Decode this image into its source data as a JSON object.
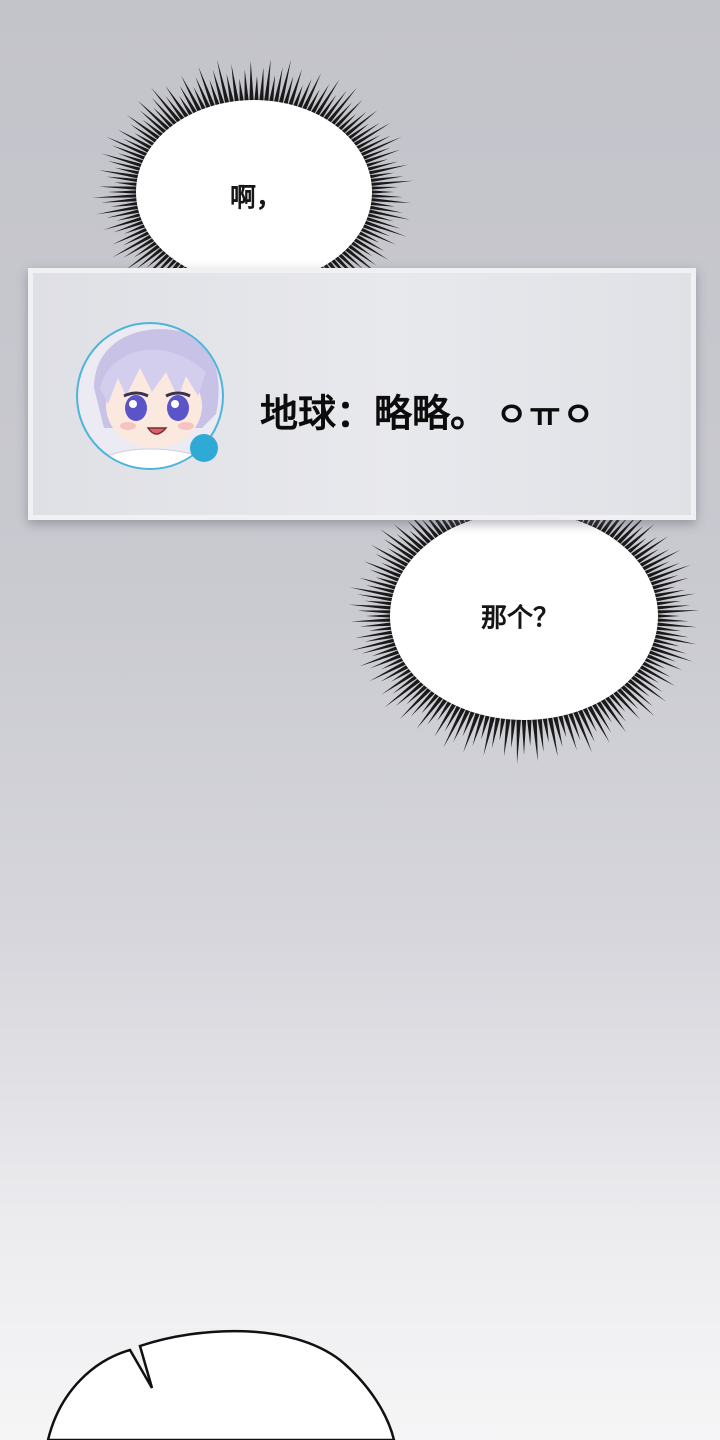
{
  "panels": {
    "bubble_top": {
      "text": "啊，"
    },
    "notification": {
      "text": "地球：略略。",
      "emoticon": "ㅇㅠㅇ",
      "avatar": {
        "icon": "chibi-character-avatar-icon",
        "ring_color": "#4fb5d8",
        "status_color": "#2fa9d6"
      }
    },
    "bubble_mid": {
      "text": "那个？"
    }
  }
}
